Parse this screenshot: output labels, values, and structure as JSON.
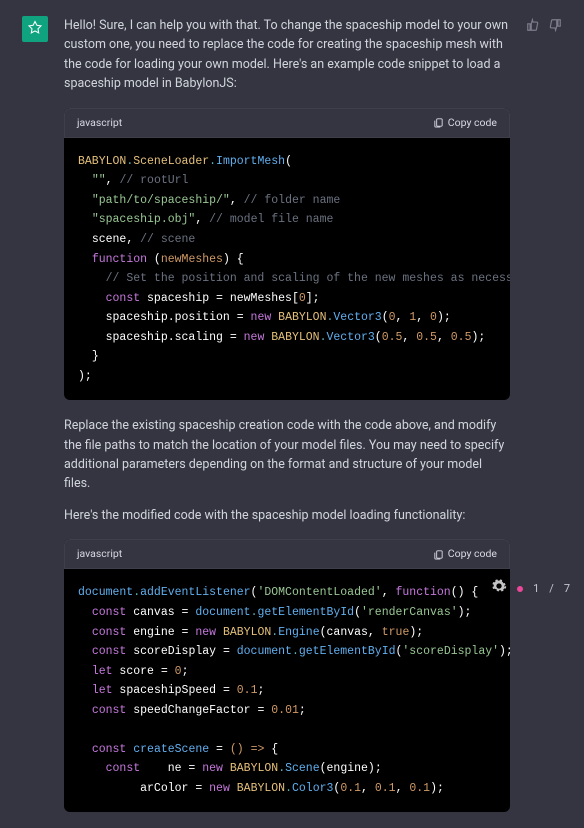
{
  "message": {
    "intro": "Hello! Sure, I can help you with that. To change the spaceship model to your own custom one, you need to replace the code for creating the spaceship mesh with the code for loading your own model. Here's an example code snippet to load a spaceship model in BabylonJS:",
    "mid1": "Replace the existing spaceship creation code with the code above, and modify the file paths to match the location of your model files. You may need to specify additional parameters depending on the format and structure of your model files.",
    "mid2": "Here's the modified code with the spaceship model loading functionality:"
  },
  "code1": {
    "lang": "javascript",
    "copy": "Copy code",
    "lines": {
      "l1a": "BABYLON",
      "l1b": ".",
      "l1c": "SceneLoader",
      "l1d": ".",
      "l1e": "ImportMesh",
      "l1f": "(",
      "l2a": "\"\"",
      "l2b": ", ",
      "l2c": "// rootUrl",
      "l3a": "\"path/to/spaceship/\"",
      "l3b": ", ",
      "l3c": "// folder name",
      "l4a": "\"spaceship.obj\"",
      "l4b": ", ",
      "l4c": "// model file name",
      "l5a": "scene, ",
      "l5c": "// scene",
      "l6a": "function",
      "l6b": " (",
      "l6c": "newMeshes",
      "l6d": ") {",
      "l7": "// Set the position and scaling of the new meshes as necessary",
      "l8a": "const",
      "l8b": " spaceship = newMeshes[",
      "l8c": "0",
      "l8d": "];",
      "l9a": "spaceship.position = ",
      "l9b": "new",
      "l9c": " ",
      "l9d": "BABYLON",
      "l9e": ".",
      "l9f": "Vector3",
      "l9g": "(",
      "l9h": "0",
      "l9i": ", ",
      "l9j": "1",
      "l9k": ", ",
      "l9l": "0",
      "l9m": ");",
      "l10a": "spaceship.scaling = ",
      "l10b": "new",
      "l10c": " ",
      "l10d": "BABYLON",
      "l10e": ".",
      "l10f": "Vector3",
      "l10g": "(",
      "l10h": "0.5",
      "l10i": ", ",
      "l10j": "0.5",
      "l10k": ", ",
      "l10l": "0.5",
      "l10m": ");",
      "l11": "}",
      "l12": ");"
    }
  },
  "code2": {
    "lang": "javascript",
    "copy": "Copy code",
    "lines": {
      "l1a": "document",
      "l1b": ".",
      "l1c": "addEventListener",
      "l1d": "(",
      "l1e": "'DOMContentLoaded'",
      "l1f": ", ",
      "l1g": "function",
      "l1h": "() {",
      "l2a": "const",
      "l2b": " canvas = ",
      "l2c": "document",
      "l2d": ".",
      "l2e": "getElementById",
      "l2f": "(",
      "l2g": "'renderCanvas'",
      "l2h": ");",
      "l3a": "const",
      "l3b": " engine = ",
      "l3c": "new",
      "l3d": " ",
      "l3e": "BABYLON",
      "l3f": ".",
      "l3g": "Engine",
      "l3h": "(canvas, ",
      "l3i": "true",
      "l3j": ");",
      "l4a": "const",
      "l4b": " scoreDisplay = ",
      "l4c": "document",
      "l4d": ".",
      "l4e": "getElementById",
      "l4f": "(",
      "l4g": "'scoreDisplay'",
      "l4h": ");",
      "l5a": "let",
      "l5b": " score = ",
      "l5c": "0",
      "l5d": ";",
      "l6a": "let",
      "l6b": " spaceshipSpeed = ",
      "l6c": "0.1",
      "l6d": ";",
      "l7a": "const",
      "l7b": " speedChangeFactor = ",
      "l7c": "0.01",
      "l7d": ";",
      "blank": " ",
      "l8a": "const",
      "l8b": " ",
      "l8c": "createScene",
      "l8d": " = ",
      "l8e": "() =>",
      "l8f": " {",
      "l9a": "const",
      "l9b": "    ne = ",
      "l9c": "new",
      "l9d": " ",
      "l9e": "BABYLON",
      "l9f": ".",
      "l9g": "Scene",
      "l9h": "(engine);",
      "l10a": "arColor = ",
      "l10b": "new",
      "l10c": " ",
      "l10d": "BABYLON",
      "l10e": ".",
      "l10f": "Color3",
      "l10g": "(",
      "l10h": "0.1",
      "l10i": ", ",
      "l10j": "0.1",
      "l10k": ", ",
      "l10l": "0.1",
      "l10m": ");"
    }
  },
  "counter": {
    "cur": "1",
    "sep": "/",
    "tot": "7"
  }
}
